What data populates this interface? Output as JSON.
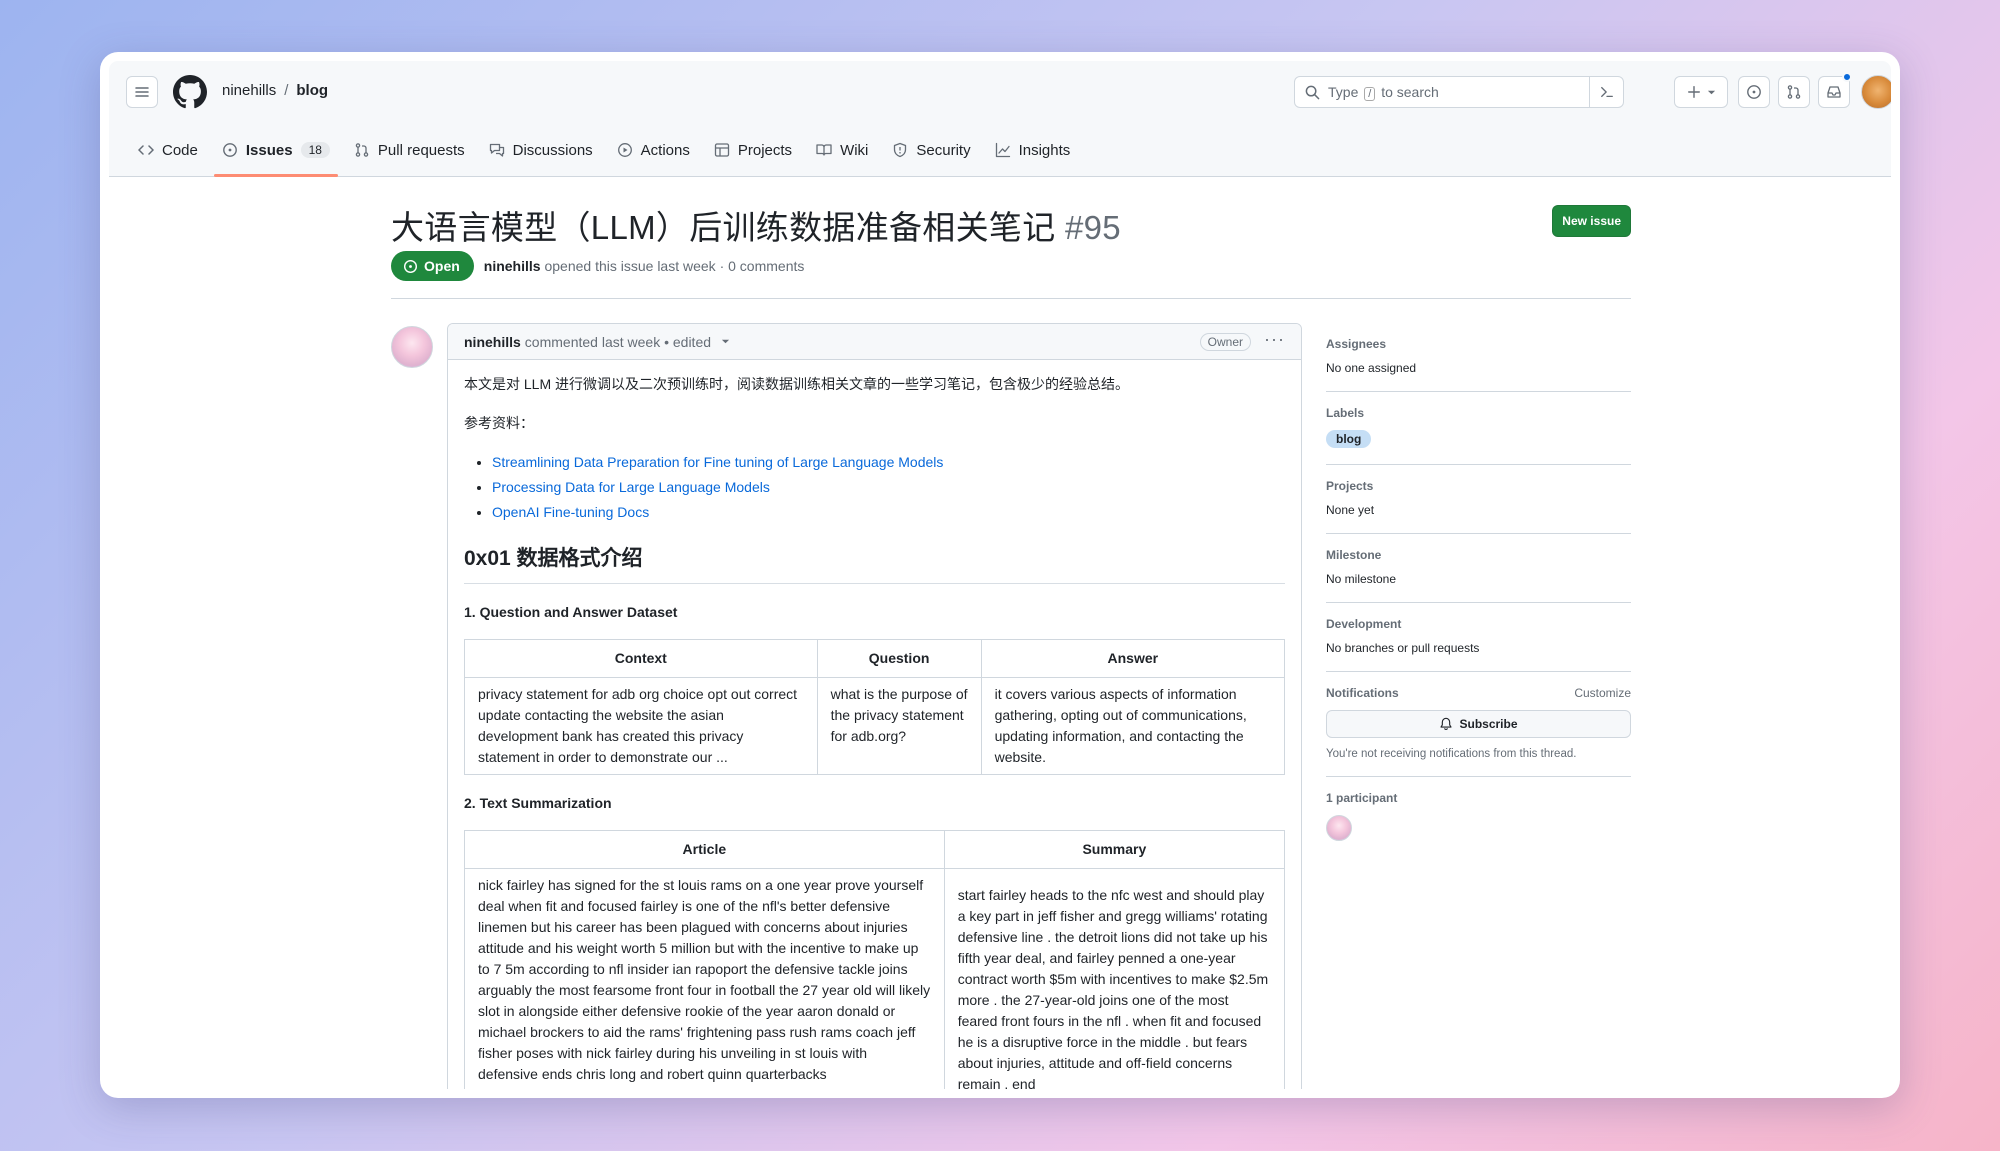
{
  "header": {
    "owner": "ninehills",
    "separator": "/",
    "repo": "blog",
    "search_prefix": "Type",
    "search_key": "/",
    "search_suffix": "to search",
    "new_icon": "plus-icon"
  },
  "tabs": [
    {
      "label": "Code",
      "icon": "code-icon"
    },
    {
      "label": "Issues",
      "icon": "issue-opened-icon",
      "count": "18",
      "active": true
    },
    {
      "label": "Pull requests",
      "icon": "git-pull-request-icon"
    },
    {
      "label": "Discussions",
      "icon": "comment-discussion-icon"
    },
    {
      "label": "Actions",
      "icon": "play-icon"
    },
    {
      "label": "Projects",
      "icon": "table-icon"
    },
    {
      "label": "Wiki",
      "icon": "book-icon"
    },
    {
      "label": "Security",
      "icon": "shield-icon"
    },
    {
      "label": "Insights",
      "icon": "graph-icon"
    }
  ],
  "issue": {
    "title": "大语言模型（LLM）后训练数据准备相关笔记",
    "number": "#95",
    "new_issue_label": "New issue",
    "state": "Open",
    "author": "ninehills",
    "meta_text": "opened this issue last week · 0 comments"
  },
  "comment": {
    "author": "ninehills",
    "meta": "commented last week • edited",
    "owner_badge": "Owner",
    "intro": "本文是对 LLM 进行微调以及二次预训练时，阅读数据训练相关文章的一些学习笔记，包含极少的经验总结。",
    "refs_title": "参考资料：",
    "links": [
      "Streamlining Data Preparation for Fine tuning of Large Language Models",
      "Processing Data for Large Language Models",
      "OpenAI Fine-tuning Docs"
    ],
    "section_title": "0x01 数据格式介绍",
    "qa_title": "1. Question and Answer Dataset",
    "qa_headers": [
      "Context",
      "Question",
      "Answer"
    ],
    "qa_row": [
      "privacy statement for adb org choice opt out correct update contacting the website the asian development bank has created this privacy statement in order to demonstrate our ...",
      "what is the purpose of the privacy statement for adb.org?",
      "it covers various aspects of information gathering, opting out of communications, updating information, and contacting the website."
    ],
    "sum_title": "2. Text Summarization",
    "sum_headers": [
      "Article",
      "Summary"
    ],
    "sum_row": [
      "nick fairley has signed for the st louis rams on a one year prove yourself deal when fit and focused fairley is one of the nfl's better defensive linemen but his career has been plagued with concerns about injuries attitude and his weight worth 5 million but with the incentive to make up to 7 5m according to nfl insider ian rapoport the defensive tackle joins arguably the most fearsome front four in football the 27 year old will likely slot in alongside either defensive rookie of the year aaron donald or michael brockers to aid the rams' frightening pass rush rams coach jeff fisher poses with nick fairley during his unveiling in st louis with defensive ends chris long and robert quinn quarterbacks",
      "start fairley heads to the nfc west and should play a key part in jeff fisher and gregg williams' rotating defensive line . the detroit lions did not take up his fifth year deal, and fairley penned a one-year contract worth $5m with incentives to make $2.5m more . the 27-year-old joins one of the most feared front fours in the nfl . when fit and focused he is a disruptive force in the middle . but fears about injuries, attitude and off-field concerns remain . end"
    ]
  },
  "sidebar": {
    "assignees_h": "Assignees",
    "assignees_v": "No one assigned",
    "labels_h": "Labels",
    "label": "blog",
    "projects_h": "Projects",
    "projects_v": "None yet",
    "milestone_h": "Milestone",
    "milestone_v": "No milestone",
    "development_h": "Development",
    "development_v": "No branches or pull requests",
    "notifications_h": "Notifications",
    "customize": "Customize",
    "subscribe": "Subscribe",
    "notif_note": "You're not receiving notifications from this thread.",
    "participants_h": "1 participant"
  },
  "colors": {
    "accent": "#1f883d",
    "link": "#0969da",
    "tab_underline": "#fd8c73",
    "label_blog": "#c5def5"
  }
}
